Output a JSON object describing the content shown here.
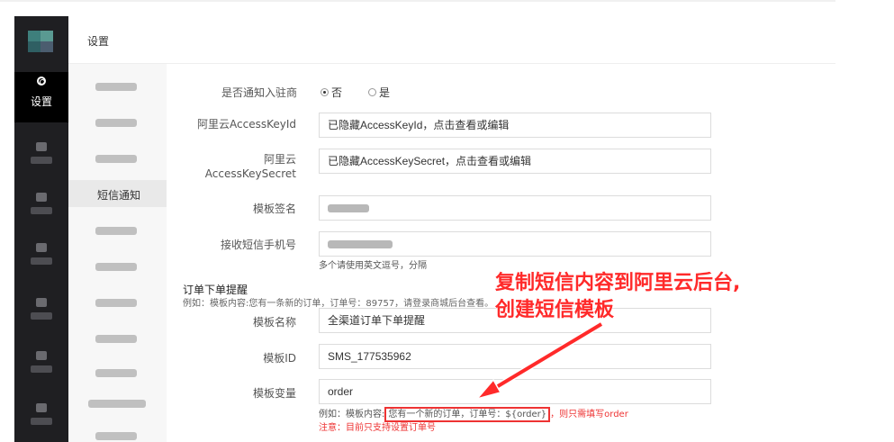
{
  "sidebar": {
    "active_label": "设置",
    "items": [
      {
        "icon": "blurred-icon"
      },
      {
        "icon": "blurred-icon"
      },
      {
        "icon": "blurred-icon"
      },
      {
        "icon": "blurred-icon"
      },
      {
        "icon": "blurred-icon"
      },
      {
        "icon": "blurred-icon"
      }
    ]
  },
  "breadcrumb": "设置",
  "submenu": {
    "active_label": "短信通知"
  },
  "form": {
    "notify_merchant": {
      "label": "是否通知入驻商",
      "options": [
        {
          "label": "否",
          "checked": true
        },
        {
          "label": "是",
          "checked": false
        }
      ]
    },
    "access_key_id": {
      "label": "阿里云AccessKeyId",
      "value": "已隐藏AccessKeyId，点击查看或编辑"
    },
    "access_key_secret": {
      "label_line1": "阿里云",
      "label_line2": "AccessKeySecret",
      "value": "已隐藏AccessKeySecret，点击查看或编辑"
    },
    "template_sign": {
      "label": "模板签名"
    },
    "receive_phone": {
      "label": "接收短信手机号",
      "hint": "多个请使用英文逗号，分隔"
    },
    "order_section": {
      "title": "订单下单提醒",
      "example": "例如：模板内容:您有一条新的订单，订单号：89757，请登录商城后台查看。"
    },
    "template_name": {
      "label": "模板名称",
      "value": "全渠道订单下单提醒"
    },
    "template_id": {
      "label": "模板ID",
      "value": "SMS_177535962"
    },
    "template_var": {
      "label": "模板变量",
      "value": "order",
      "example_prefix": "例如：模板内容:",
      "example_boxed": "您有一个新的订单，订单号：${order}",
      "example_suffix": "，则只需填写order",
      "note": "注意：目前只支持设置订单号"
    }
  },
  "annotation": {
    "line1": "复制短信内容到阿里云后台,",
    "line2": "创建短信模板",
    "color": "#ff2a2a"
  }
}
